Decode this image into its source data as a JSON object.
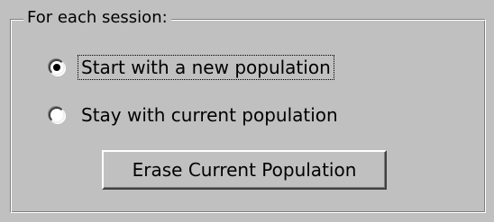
{
  "group": {
    "title": "For each session:"
  },
  "options": [
    {
      "label": "Start with a new population",
      "selected": true,
      "focused": true
    },
    {
      "label": "Stay with current population",
      "selected": false,
      "focused": false
    }
  ],
  "erase_button": {
    "label": "Erase Current Population"
  }
}
